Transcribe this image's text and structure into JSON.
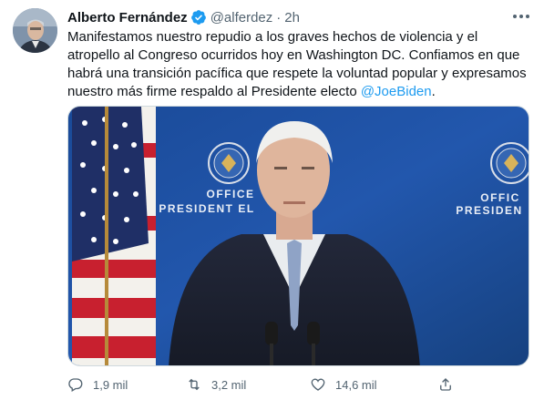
{
  "tweet": {
    "author_name": "Alberto Fernández",
    "handle": "@alferdez",
    "separator": "·",
    "time": "2h",
    "text_before": "Manifestamos nuestro repudio a los graves hechos de violencia y el atropello al Congreso ocurridos hoy en Washington DC. Confiamos en que habrá una transición pacífica que respete la voluntad popular y expresamos nuestro más firme respaldo al Presidente electo ",
    "mention": "@JoeBiden",
    "text_after": ".",
    "media": {
      "sign_left_line1": "OFFICE",
      "sign_left_line2": "PRESIDENT EL",
      "sign_right_line1": "OFFIC",
      "sign_right_line2": "PRESIDEN"
    },
    "actions": {
      "replies": "1,9 mil",
      "retweets": "3,2 mil",
      "likes": "14,6 mil"
    }
  },
  "colors": {
    "accent": "#1d9bf0",
    "muted": "#536471",
    "backdrop": "#1d4fa0"
  },
  "icons": [
    "verified-icon",
    "more-icon",
    "reply-icon",
    "retweet-icon",
    "like-icon",
    "share-icon"
  ]
}
